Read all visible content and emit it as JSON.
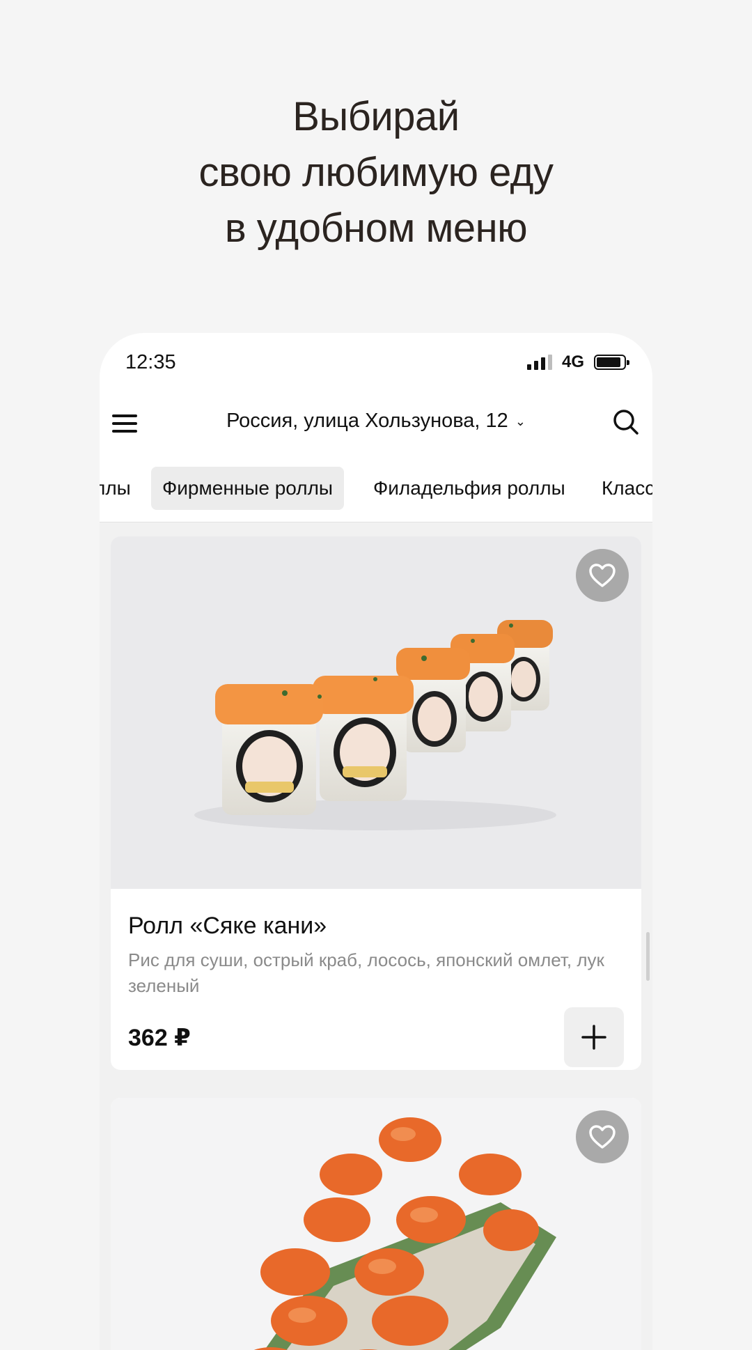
{
  "headline": {
    "line1": "Выбирай",
    "line2": "свою любимую еду",
    "line3": "в удобном меню"
  },
  "status": {
    "time": "12:35",
    "network": "4G"
  },
  "header": {
    "address": "Россия, улица Хользунова, 12"
  },
  "tabs": [
    {
      "label": "ллы"
    },
    {
      "label": "Фирменные роллы",
      "active": true
    },
    {
      "label": "Филадельфия роллы"
    },
    {
      "label": "Класс"
    }
  ],
  "products": [
    {
      "title": "Ролл «Сяке кани»",
      "description": "Рис для суши, острый краб, лосось, японский омлет, лук зеленый",
      "price": "362 ₽",
      "image": "sushi-roll-photo"
    },
    {
      "image": "salmon-roll-photo"
    }
  ],
  "icons": {
    "menu": "hamburger-icon",
    "search": "search-icon",
    "favorite": "heart-icon",
    "add": "plus-icon"
  }
}
